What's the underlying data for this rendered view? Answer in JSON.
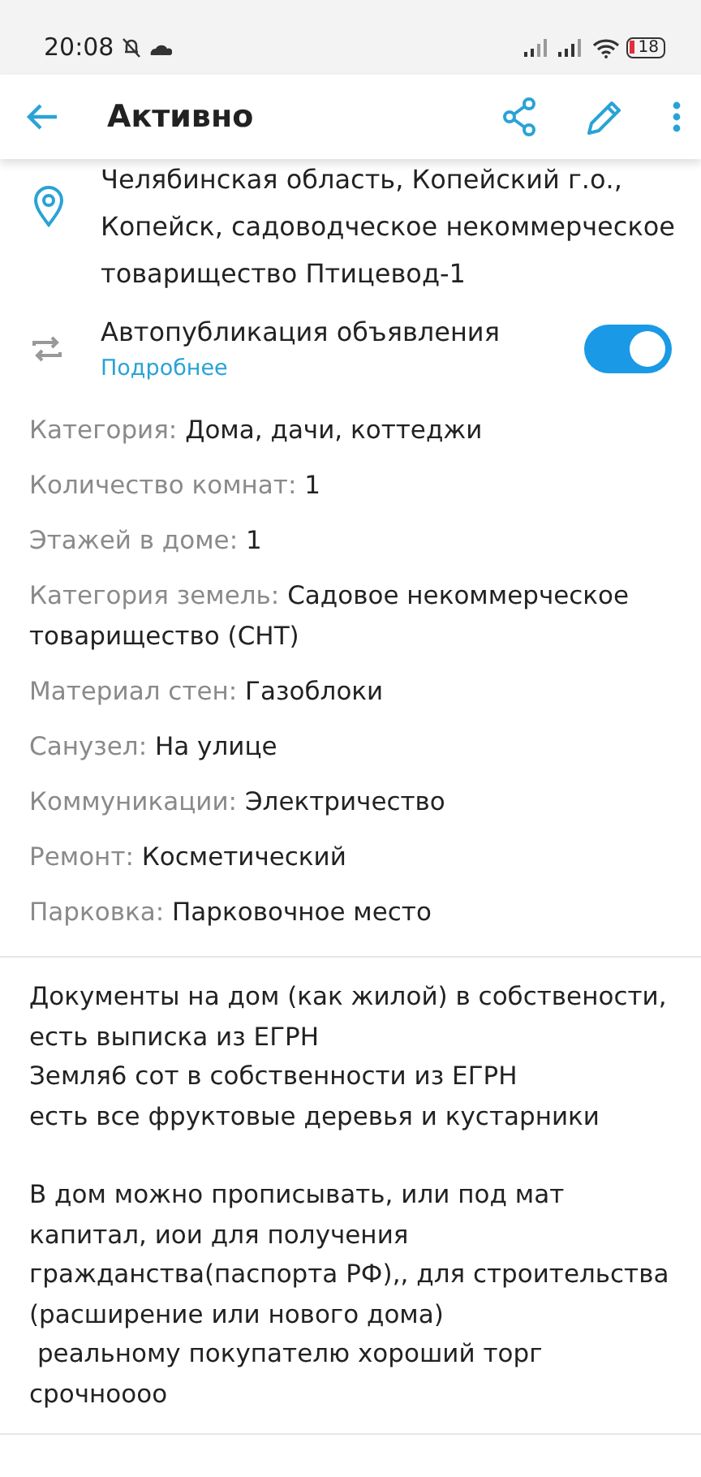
{
  "status_bar": {
    "time": "20:08",
    "battery": "18"
  },
  "app_bar": {
    "title": "Активно"
  },
  "address": "Челябинская область, Копейский г.о., Копейск, садоводческое некоммерческое товарищество Птицевод-1",
  "autopublish": {
    "label": "Автопубликация объявления",
    "link": "Подробнее",
    "on": true
  },
  "specs": [
    {
      "label": "Категория:",
      "value": "Дома, дачи, коттеджи"
    },
    {
      "label": "Количество комнат:",
      "value": "1"
    },
    {
      "label": "Этажей в доме:",
      "value": "1"
    },
    {
      "label": "Категория земель:",
      "value": "Садовое некоммерческое товарищество (СНТ)"
    },
    {
      "label": "Материал стен:",
      "value": "Газоблоки"
    },
    {
      "label": "Санузел:",
      "value": "На улице"
    },
    {
      "label": "Коммуникации:",
      "value": "Электричество"
    },
    {
      "label": "Ремонт:",
      "value": "Косметический"
    },
    {
      "label": "Парковка:",
      "value": "Парковочное место"
    }
  ],
  "description": [
    [
      "Документы на дом (как жилой) в собствености,",
      "есть выписка из ЕГРН",
      "Земля6 сот в собственности из ЕГРН",
      "есть все фруктовые деревья и кустарники"
    ],
    [
      "В дом можно прописывать, или под мат капитал, иои для получения гражданства(паспорта РФ),, для строительства (расширение или нового дома)",
      " реальному покупателю хороший торг",
      "срочноооо"
    ]
  ]
}
